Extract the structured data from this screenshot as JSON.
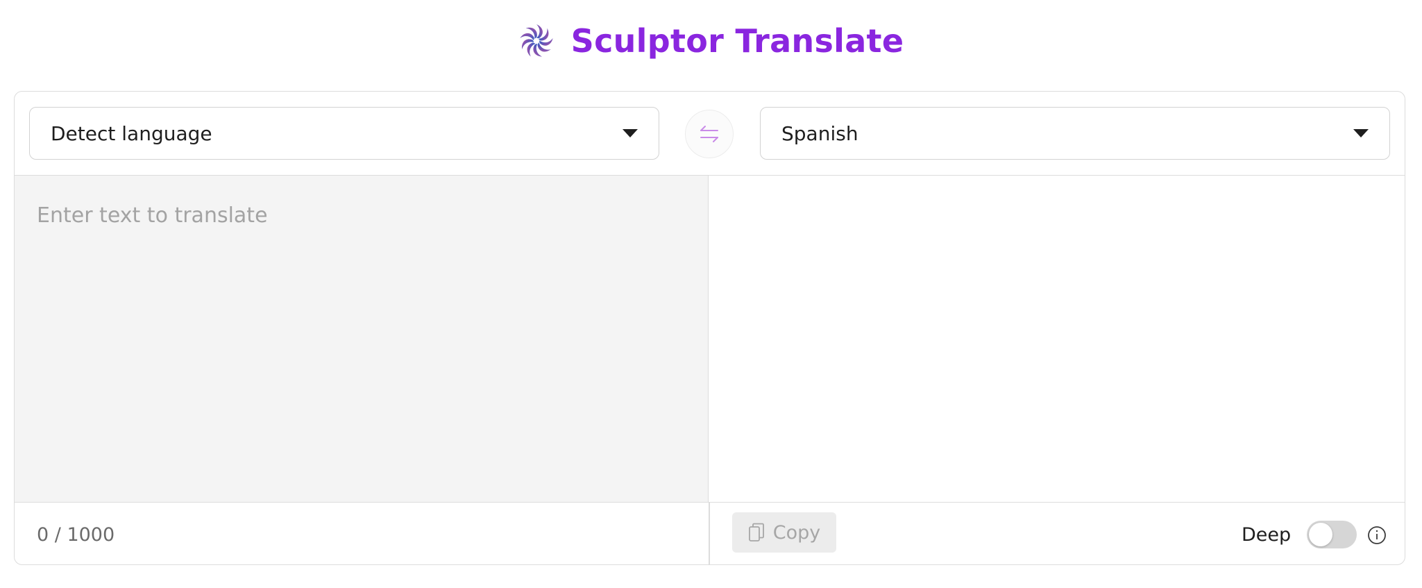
{
  "app": {
    "title": "Sculptor Translate",
    "logo_icon": "spiral-logo-icon",
    "title_color": "#8a26df"
  },
  "languages": {
    "source_selected": "Detect language",
    "target_selected": "Spanish",
    "swap_icon": "swap-arrows-icon"
  },
  "source": {
    "value": "",
    "placeholder": "Enter text to translate"
  },
  "target": {
    "value": ""
  },
  "footer": {
    "char_count": "0 / 1000",
    "copy_label": "Copy",
    "copy_icon": "copy-icon",
    "deep_label": "Deep",
    "deep_enabled": false,
    "info_icon": "info-icon"
  }
}
